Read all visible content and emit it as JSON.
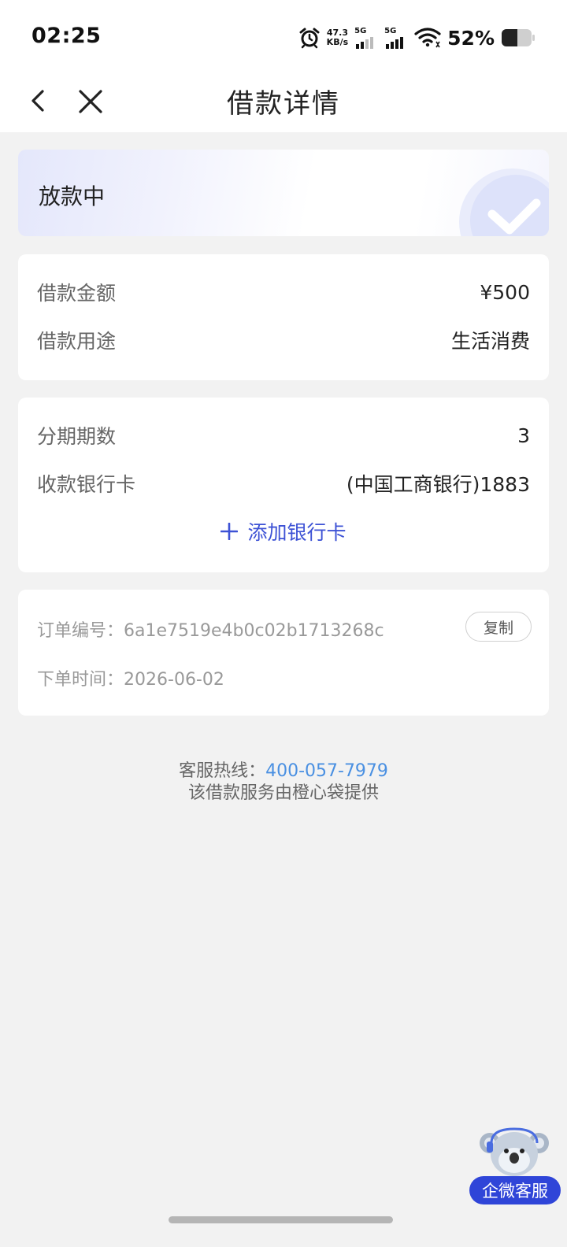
{
  "status_bar": {
    "time": "02:25",
    "net_speed_value": "47.3",
    "net_speed_unit": "KB/s",
    "signal_1_label": "5G",
    "signal_2_label": "5G",
    "battery_percent": "52%"
  },
  "nav": {
    "title": "借款详情"
  },
  "loan_status": {
    "text": "放款中"
  },
  "loan_info": {
    "amount_label": "借款金额",
    "amount_value": "¥500",
    "purpose_label": "借款用途",
    "purpose_value": "生活消费"
  },
  "repayment": {
    "installments_label": "分期期数",
    "installments_value": "3",
    "bank_card_label": "收款银行卡",
    "bank_card_value": "(中国工商银行)1883",
    "add_card_label": "添加银行卡"
  },
  "order": {
    "order_no_label": "订单编号：",
    "order_no_value": "6a1e7519e4b0c02b1713268c",
    "copy_label": "复制",
    "order_time_label": "下单时间：",
    "order_time_value": "2026-06-02"
  },
  "footer": {
    "hotline_label": "客服热线：",
    "hotline_number": "400-057-7979",
    "provider_text": "该借款服务由橙心袋提供"
  },
  "support": {
    "label": "企微客服"
  },
  "colors": {
    "accent_blue": "#3d52d5",
    "link_blue": "#4a90e2",
    "background": "#f2f2f2"
  },
  "icons": {
    "back": "chevron-left-icon",
    "close": "close-icon",
    "plus": "plus-icon",
    "alarm": "alarm-icon",
    "wifi": "wifi-icon",
    "battery": "battery-icon",
    "check": "check-icon",
    "koala": "koala-mascot-icon"
  }
}
